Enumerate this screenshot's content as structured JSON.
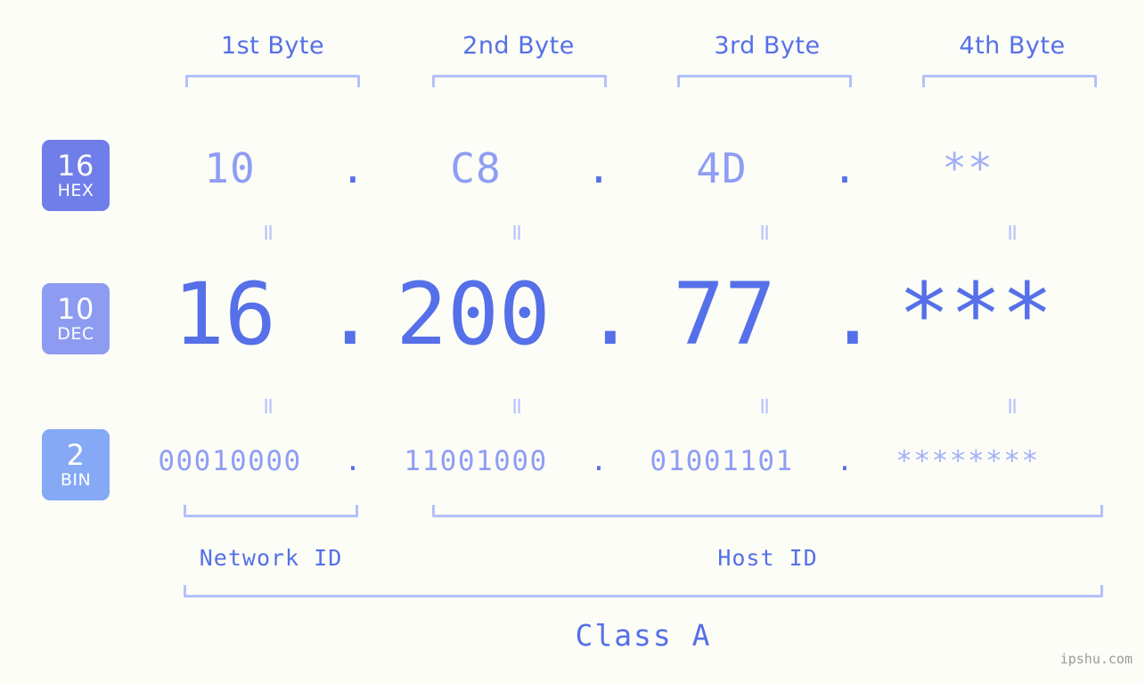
{
  "page": {
    "background_color": "#fcfdf7",
    "accent_color": "#5570e8",
    "light_accent_color": "#8f9df4",
    "bracket_color": "#b3c0fb"
  },
  "byte_headers": [
    {
      "label": "1st Byte"
    },
    {
      "label": "2nd Byte"
    },
    {
      "label": "3rd Byte"
    },
    {
      "label": "4th Byte"
    }
  ],
  "radix_badges": [
    {
      "number": "16",
      "name": "HEX",
      "color": "#6f7ee8"
    },
    {
      "number": "10",
      "name": "DEC",
      "color": "#8d9cf0"
    },
    {
      "number": "2",
      "name": "BIN",
      "color": "#86a9f6"
    }
  ],
  "rows": {
    "hex": {
      "radix": "16",
      "radix_name": "HEX",
      "values": [
        "10",
        "C8",
        "4D",
        "**"
      ],
      "separator": "."
    },
    "dec": {
      "radix": "10",
      "radix_name": "DEC",
      "values": [
        "16",
        "200",
        "77",
        "***"
      ],
      "separator": "."
    },
    "bin": {
      "radix": "2",
      "radix_name": "BIN",
      "values": [
        "00010000",
        "11001000",
        "01001101",
        "********"
      ],
      "separator": "."
    }
  },
  "equals_connector": "=",
  "segments": {
    "network_id": "Network ID",
    "host_id": "Host ID",
    "class": "Class A"
  },
  "watermark": "ipshu.com"
}
